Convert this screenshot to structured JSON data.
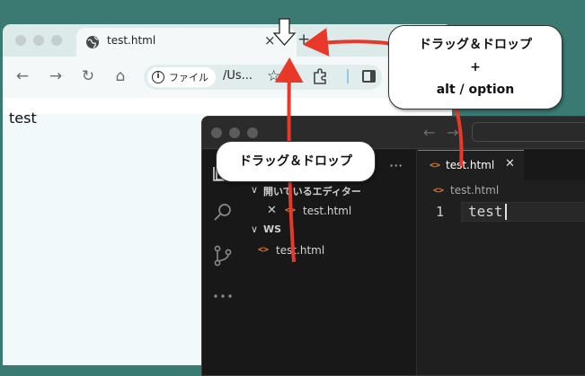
{
  "chrome": {
    "tab_title": "test.html",
    "tab_close": "×",
    "new_tab": "+",
    "toolbar": {
      "back": "←",
      "forward": "→",
      "reload": "↻",
      "home": "⌂"
    },
    "omnibox": {
      "chip_label": "ファイル",
      "url": "/Us...",
      "star": "☆"
    },
    "page_text": "test",
    "icons": [
      "globe-icon",
      "info-icon",
      "star-icon",
      "extensions-icon",
      "side-panel-icon"
    ]
  },
  "vscode": {
    "title_nav": {
      "back": "←",
      "forward": "→"
    },
    "sidebar": {
      "more": "···",
      "open_editors": {
        "chevron": "∨",
        "label": "開いているエディター",
        "close": "✕",
        "file": "test.html"
      },
      "workspace": {
        "chevron": "∨",
        "label": "WS",
        "file": "test.html"
      }
    },
    "editor": {
      "tab": {
        "file": "test.html",
        "close": "✕"
      },
      "breadcrumb_file": "test.html",
      "line_number": "1",
      "code": "test"
    },
    "icons": [
      "explorer-icon",
      "search-icon",
      "source-control-icon",
      "more-icon",
      "html-file-icon"
    ]
  },
  "callouts": {
    "top": {
      "line1": "ドラッグ＆ドロップ",
      "line2": "+",
      "line3": "alt / option"
    },
    "middle": "ドラッグ＆ドロップ"
  },
  "colors": {
    "arrow": "#e8382a",
    "vscode_bg": "#1f1f1f",
    "chrome_bg": "#f4f8f8",
    "html_icon": "#e37933"
  }
}
